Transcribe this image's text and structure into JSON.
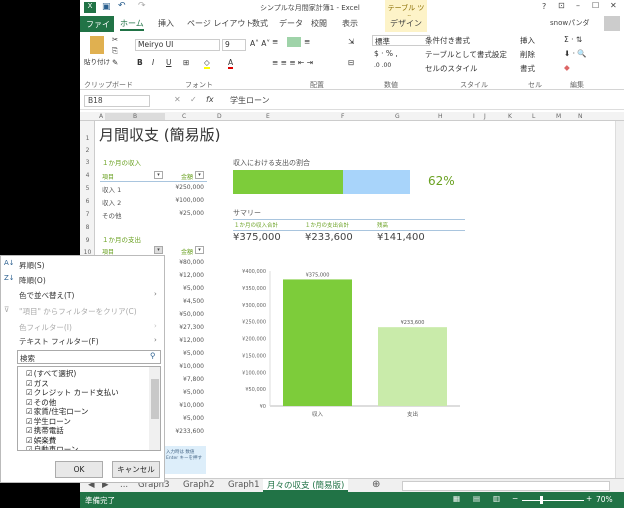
{
  "window": {
    "title": "シンプルな月間家計簿1 - Excel",
    "context_tab": "テーブル ツール",
    "user": "snowパンダ"
  },
  "tabs": [
    "ファイル",
    "ホーム",
    "挿入",
    "ページ レイアウト",
    "数式",
    "データ",
    "校閲",
    "表示",
    "デザイン"
  ],
  "ribbon": {
    "paste": "貼り付け",
    "font_name": "Meiryo UI",
    "font_size": "9",
    "number_format": "標準",
    "cond_format": "条件付き書式",
    "table_format": "テーブルとして書式設定",
    "cell_style": "セルのスタイル",
    "insert": "挿入",
    "delete": "削除",
    "format": "書式",
    "groups": [
      "クリップボード",
      "フォント",
      "配置",
      "数値",
      "スタイル",
      "セル",
      "編集"
    ]
  },
  "formula_bar": {
    "name_box": "B18",
    "fx": "fx",
    "content": "学生ローン"
  },
  "columns": [
    "A",
    "B",
    "C",
    "D",
    "E",
    "F",
    "G",
    "H",
    "I",
    "J",
    "K",
    "L",
    "M",
    "N"
  ],
  "rows": [
    "1",
    "2",
    "3",
    "4",
    "5",
    "6",
    "7",
    "8",
    "9",
    "10"
  ],
  "sheet": {
    "title": "月間収支 (簡易版)",
    "income": {
      "heading": "１か月の収入",
      "col_item": "項目",
      "col_amount": "金額",
      "rows": [
        {
          "item": "収入 1",
          "amount": "¥250,000"
        },
        {
          "item": "収入 2",
          "amount": "¥100,000"
        },
        {
          "item": "その他",
          "amount": "¥25,000"
        }
      ]
    },
    "expense": {
      "heading": "１か月の支出",
      "col_item": "項目",
      "col_amount": "金額",
      "amounts": [
        "¥80,000",
        "¥12,000",
        "¥5,000",
        "¥4,500",
        "¥50,000",
        "¥27,300",
        "¥12,000",
        "¥5,000",
        "¥10,000",
        "¥7,800",
        "¥5,000",
        "¥10,000",
        "¥5,000",
        "¥233,600"
      ]
    },
    "ratio": {
      "label": "収入における支出の割合",
      "percent": "62%",
      "value": 0.62
    },
    "summary": {
      "heading": "サマリー",
      "labels": [
        "１か月の収入合計",
        "１か月の支出合計",
        "残高"
      ],
      "values": [
        "¥375,000",
        "¥233,600",
        "¥141,400"
      ]
    },
    "note": [
      "入力時は 数値",
      "Enter キーを押す"
    ]
  },
  "chart_data": {
    "type": "bar",
    "categories": [
      "収入",
      "支出"
    ],
    "values": [
      375000,
      233600
    ],
    "data_labels": [
      "¥375,000",
      "¥233,600"
    ],
    "ylim": [
      0,
      400000
    ],
    "yticks": [
      "¥0",
      "¥50,000",
      "¥100,000",
      "¥150,000",
      "¥200,000",
      "¥250,000",
      "¥300,000",
      "¥350,000",
      "¥400,000"
    ],
    "colors": [
      "#7dcc3a",
      "#c9ebaa"
    ]
  },
  "filter_menu": {
    "sort_asc": "昇順(S)",
    "sort_desc": "降順(O)",
    "sort_color": "色で並べ替え(T)",
    "clear": "\"項目\" からフィルターをクリア(C)",
    "color_filter": "色フィルター(I)",
    "text_filter": "テキスト フィルター(F)",
    "search_placeholder": "検索",
    "items": [
      "(すべて選択)",
      "ガス",
      "クレジット カード支払い",
      "その他",
      "家賃/住宅ローン",
      "学生ローン",
      "携帯電話",
      "娯楽費",
      "自動車ローン"
    ],
    "ok": "OK",
    "cancel": "キャンセル"
  },
  "sheet_tabs": [
    "...",
    "Graph3",
    "Graph2",
    "Graph1",
    "月々の収支 (簡易版)"
  ],
  "status": {
    "ready": "準備完了",
    "zoom": "70%"
  }
}
